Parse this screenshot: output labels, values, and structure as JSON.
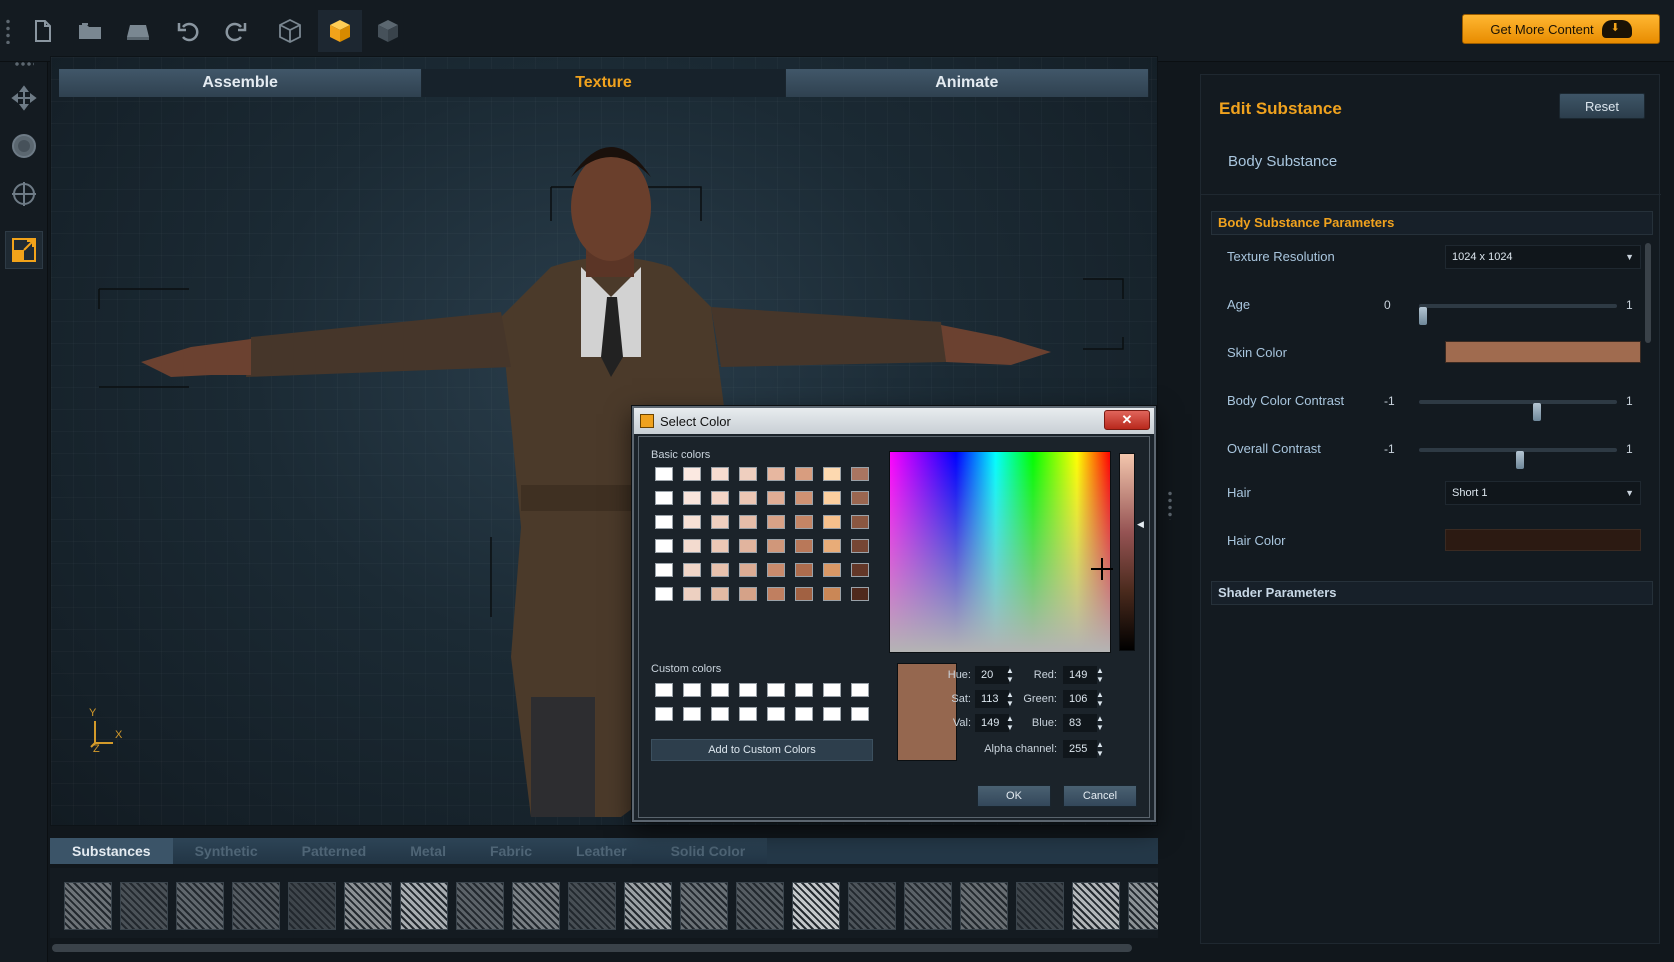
{
  "toolbar": {
    "get_more_label": "Get More Content",
    "buttons": [
      "new-file-icon",
      "open-folder-icon",
      "save-icon",
      "undo-icon",
      "redo-icon",
      "box-wire-icon",
      "box-solid-icon",
      "box-dark-icon"
    ]
  },
  "mode_tabs": [
    {
      "label": "Assemble",
      "active": false
    },
    {
      "label": "Texture",
      "active": true
    },
    {
      "label": "Animate",
      "active": false
    }
  ],
  "viewport": {
    "axis_labels": {
      "y": "Y",
      "x": "X",
      "z": "Z"
    }
  },
  "material_tabs": [
    {
      "label": "Substances",
      "active": true
    },
    {
      "label": "Synthetic",
      "active": false
    },
    {
      "label": "Patterned",
      "active": false
    },
    {
      "label": "Metal",
      "active": false
    },
    {
      "label": "Fabric",
      "active": false
    },
    {
      "label": "Leather",
      "active": false
    },
    {
      "label": "Solid Color",
      "active": false
    }
  ],
  "swatch_shades": [
    "#6d7378",
    "#4a5157",
    "#5f666c",
    "#545b61",
    "#3e454b",
    "#8b9094",
    "#a7acb0",
    "#5b6268",
    "#7a8085",
    "#474e54",
    "#9aa0a4",
    "#6a7176",
    "#555c62",
    "#c3c7ca",
    "#4d545a",
    "#5a6167",
    "#686e73",
    "#3f464c",
    "#b2b6b9",
    "#8c9296"
  ],
  "edit_substance": {
    "title": "Edit Substance",
    "reset_label": "Reset",
    "substance_name": "Body Substance"
  },
  "params": {
    "section_title": "Body Substance Parameters",
    "texture_resolution": {
      "label": "Texture Resolution",
      "value": "1024 x 1024"
    },
    "age": {
      "label": "Age",
      "min": "0",
      "max": "1",
      "value": 0.0
    },
    "skin_color": {
      "label": "Skin Color",
      "color": "#a06b4f"
    },
    "body_color_contrast": {
      "label": "Body Color Contrast",
      "min": "-1",
      "max": "1",
      "value": 0.2
    },
    "overall_contrast": {
      "label": "Overall Contrast",
      "min": "-1",
      "max": "1",
      "value": 0.02
    },
    "hair": {
      "label": "Hair",
      "value": "Short 1"
    },
    "hair_color": {
      "label": "Hair Color",
      "color": "#2c1a12"
    }
  },
  "shader": {
    "section_title": "Shader Parameters"
  },
  "dialog": {
    "title": "Select Color",
    "close_label": "✕",
    "basic_colors_label": "Basic colors",
    "custom_colors_label": "Custom colors",
    "add_custom_label": "Add to Custom Colors",
    "ok_label": "OK",
    "cancel_label": "Cancel",
    "basic_colors": [
      [
        "#ffffff",
        "#fbe9e1",
        "#f6dcd0",
        "#efcfbf",
        "#e7b7a0",
        "#d89d7f",
        "#fdd9b0",
        "#a97561"
      ],
      [
        "#ffffff",
        "#f9e5dc",
        "#f3d5c7",
        "#ebc6b4",
        "#e0ad95",
        "#cf9273",
        "#fccf9f",
        "#9a6650"
      ],
      [
        "#ffffff",
        "#f6e0d5",
        "#efcfbf",
        "#e6bda9",
        "#d8a287",
        "#c48565",
        "#f6c08c",
        "#8a5741"
      ],
      [
        "#ffffff",
        "#f3dbcf",
        "#ebc8b6",
        "#e1b49e",
        "#d0977a",
        "#b97859",
        "#e8ac78",
        "#764634"
      ],
      [
        "#ffffff",
        "#f0d6c8",
        "#e7c1ad",
        "#dbab93",
        "#c98b6d",
        "#ad6c4d",
        "#d99866",
        "#633728"
      ],
      [
        "#ffffff",
        "#edd0c1",
        "#e2baa4",
        "#d5a288",
        "#c07f60",
        "#a16142",
        "#ca8756",
        "#4f291d"
      ]
    ],
    "custom_rows": 2,
    "custom_cols": 8,
    "fields": {
      "hue": {
        "label": "Hue:",
        "value": "20"
      },
      "sat": {
        "label": "Sat:",
        "value": "113"
      },
      "val": {
        "label": "Val:",
        "value": "149"
      },
      "red": {
        "label": "Red:",
        "value": "149"
      },
      "green": {
        "label": "Green:",
        "value": "106"
      },
      "blue": {
        "label": "Blue:",
        "value": "83"
      },
      "alpha": {
        "label": "Alpha channel:",
        "value": "255"
      }
    },
    "preview_color": "#95674f"
  }
}
